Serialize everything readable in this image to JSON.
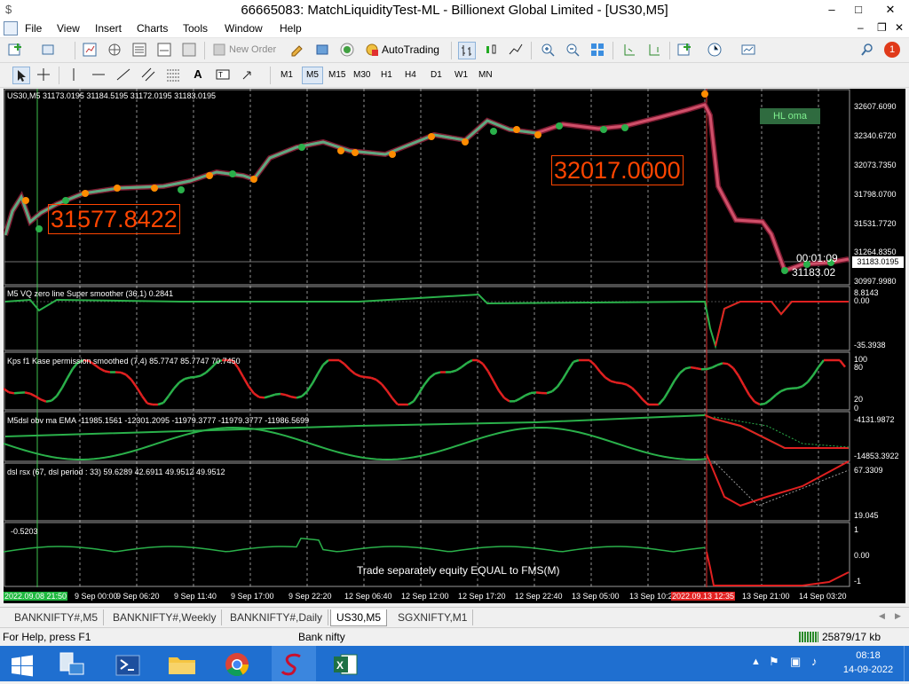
{
  "window": {
    "title": "66665083: MatchLiquidityTest-ML - Billionext Global Limited - [US30,M5]",
    "controls": [
      "–",
      "□",
      "✕"
    ],
    "inner_controls": [
      "–",
      "❐",
      "✕"
    ]
  },
  "menu": [
    "File",
    "View",
    "Insert",
    "Charts",
    "Tools",
    "Window",
    "Help"
  ],
  "toolbar": {
    "new_order": "New Order",
    "autotrading": "AutoTrading",
    "notification_count": "1"
  },
  "timeframes": [
    "M1",
    "M5",
    "M15",
    "M30",
    "H1",
    "H4",
    "D1",
    "W1",
    "MN"
  ],
  "active_timeframe": "M5",
  "chart": {
    "header": "US30,M5  31173.0195 31184.5195 31172.0195 31183.0195",
    "price_axis": [
      "32607.6090",
      "32340.6720",
      "32073.7350",
      "31798.0700",
      "31531.7720",
      "31264.8350",
      "30997.9980"
    ],
    "current_price": "31183.0195",
    "countdown": "00:01:09",
    "bid_label": "31183.02",
    "label_left": "31577.8422",
    "label_right": "32017.0000",
    "legend_box": "HL oma",
    "colors": {
      "up": "#1e9e3a",
      "down": "#c0304a",
      "orange": "#ff8c00",
      "label": "#ff4500",
      "bg": "#000000",
      "axis": "#ffffff"
    }
  },
  "panels": [
    {
      "label": "M5 VQ zero line Super smoother (36,1) 0.2841",
      "axis": [
        "8.8143",
        "0.00",
        "-35.3938"
      ]
    },
    {
      "label": "Kps f1 Kase permission smoothed (7,4) 85.7747 85.7747 70.7450",
      "axis": [
        "100",
        "80",
        "20",
        "0"
      ]
    },
    {
      "label": "M5dsl  obv ma  EMA  -11985.1561 -12301.2095 -11979.3777 -11979.3777 -11986.5699",
      "axis": [
        "-4131.9872",
        "-14853.3922"
      ]
    },
    {
      "label": "dsl rsx (67, dsl period : 33) 59.6289 42.6911 49.9512 49.9512",
      "axis": [
        "67.3309",
        "19.045"
      ]
    },
    {
      "label": "-0.5203",
      "axis": [
        "1",
        "0.00",
        "-1"
      ],
      "note": "Trade separately equity EQUAL  to FMS(M)"
    }
  ],
  "time_axis": [
    "2022.09.08 21:50",
    "9 Sep 00:00",
    "9 Sep 06:20",
    "9 Sep 11:40",
    "9 Sep 17:00",
    "9 Sep 22:20",
    "12 Sep 06:40",
    "12 Sep 12:00",
    "12 Sep 17:20",
    "12 Sep 22:40",
    "13 Sep 05:00",
    "13 Sep 10:2",
    "2022.09.13 12:35",
    "13 Sep 21:00",
    "14 Sep 03:20"
  ],
  "tabs": [
    "BANKNIFTY#,M5",
    "BANKNIFTY#,Weekly",
    "BANKNIFTY#,Daily",
    "US30,M5",
    "SGXNIFTY,M1"
  ],
  "active_tab": "US30,M5",
  "status": {
    "help": "For Help, press F1",
    "profile": "Bank nifty",
    "traffic": "25879/17 kb"
  },
  "taskbar": {
    "time": "08:18",
    "date": "14-09-2022"
  }
}
